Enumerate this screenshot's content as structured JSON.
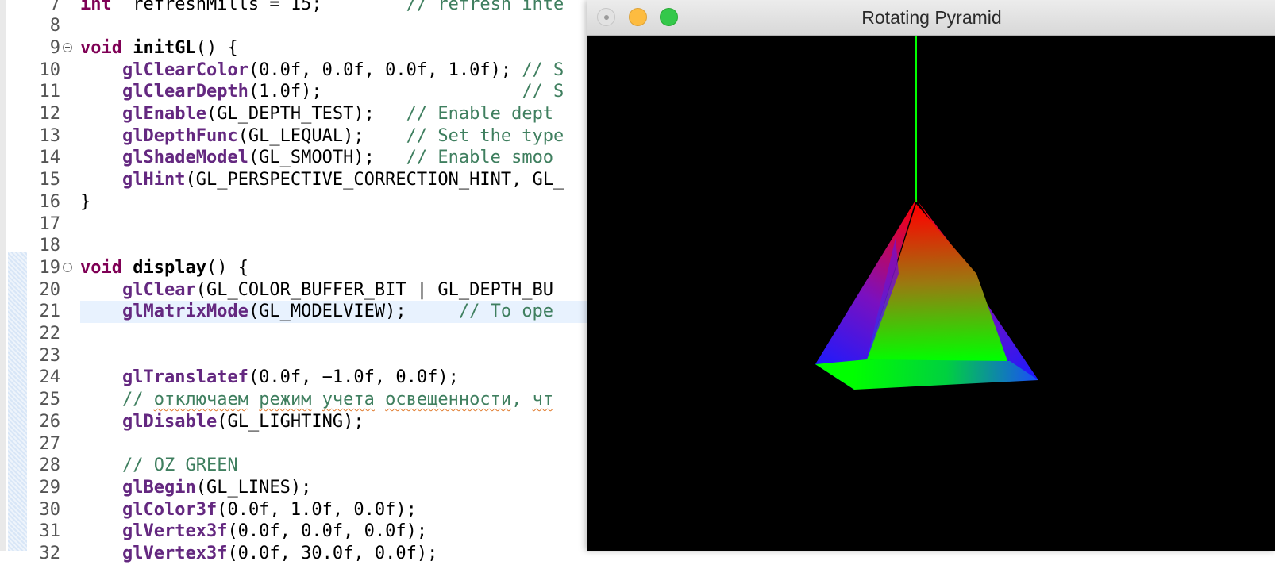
{
  "editor": {
    "lines": [
      {
        "num": "7",
        "parts": [
          [
            "kw",
            "int"
          ],
          [
            "",
            "  refreshMills = 15;"
          ],
          [
            "cm",
            "        // refresh inte"
          ]
        ]
      },
      {
        "num": "8",
        "parts": []
      },
      {
        "num": "9",
        "fold": true,
        "parts": [
          [
            "kw",
            "void"
          ],
          [
            "",
            " "
          ],
          [
            "fnn",
            "initGL"
          ],
          [
            "",
            "() {"
          ]
        ]
      },
      {
        "num": "10",
        "parts": [
          [
            "",
            "    "
          ],
          [
            "fn",
            "glClearColor"
          ],
          [
            "",
            "(0.0f, 0.0f, 0.0f, 1.0f); "
          ],
          [
            "cm",
            "// S"
          ]
        ]
      },
      {
        "num": "11",
        "parts": [
          [
            "",
            "    "
          ],
          [
            "fn",
            "glClearDepth"
          ],
          [
            "",
            "(1.0f);                   "
          ],
          [
            "cm",
            "// S"
          ]
        ]
      },
      {
        "num": "12",
        "parts": [
          [
            "",
            "    "
          ],
          [
            "fn",
            "glEnable"
          ],
          [
            "",
            "(GL_DEPTH_TEST);   "
          ],
          [
            "cm",
            "// Enable dept"
          ]
        ]
      },
      {
        "num": "13",
        "parts": [
          [
            "",
            "    "
          ],
          [
            "fn",
            "glDepthFunc"
          ],
          [
            "",
            "(GL_LEQUAL);    "
          ],
          [
            "cm",
            "// Set the type"
          ]
        ]
      },
      {
        "num": "14",
        "parts": [
          [
            "",
            "    "
          ],
          [
            "fn",
            "glShadeModel"
          ],
          [
            "",
            "(GL_SMOOTH);   "
          ],
          [
            "cm",
            "// Enable smoo"
          ]
        ]
      },
      {
        "num": "15",
        "parts": [
          [
            "",
            "    "
          ],
          [
            "fn",
            "glHint"
          ],
          [
            "",
            "(GL_PERSPECTIVE_CORRECTION_HINT, GL_"
          ]
        ]
      },
      {
        "num": "16",
        "parts": [
          [
            "",
            "}"
          ]
        ]
      },
      {
        "num": "17",
        "parts": []
      },
      {
        "num": "18",
        "parts": []
      },
      {
        "num": "19",
        "fold": true,
        "parts": [
          [
            "kw",
            "void"
          ],
          [
            "",
            " "
          ],
          [
            "fnn",
            "display"
          ],
          [
            "",
            "() {"
          ]
        ]
      },
      {
        "num": "20",
        "parts": [
          [
            "",
            "    "
          ],
          [
            "fn",
            "glClear"
          ],
          [
            "",
            "(GL_COLOR_BUFFER_BIT | GL_DEPTH_BU"
          ]
        ]
      },
      {
        "num": "21",
        "current": true,
        "parts": [
          [
            "",
            "    "
          ],
          [
            "fn",
            "glMatrixMode"
          ],
          [
            "",
            "(GL_MODELVIEW);     "
          ],
          [
            "cm",
            "// To ope"
          ]
        ]
      },
      {
        "num": "22",
        "parts": []
      },
      {
        "num": "23",
        "parts": []
      },
      {
        "num": "24",
        "parts": [
          [
            "",
            "    "
          ],
          [
            "fn",
            "glTranslatef"
          ],
          [
            "",
            "(0.0f, −1.0f, 0.0f);"
          ]
        ]
      },
      {
        "num": "25",
        "parts": [
          [
            "",
            "    "
          ],
          [
            "cm",
            "// "
          ],
          [
            "cm sq",
            "отключаем"
          ],
          [
            "cm",
            " "
          ],
          [
            "cm sq",
            "режим"
          ],
          [
            "cm",
            " "
          ],
          [
            "cm sq",
            "учета"
          ],
          [
            "cm",
            " "
          ],
          [
            "cm sq",
            "освещенности"
          ],
          [
            "cm",
            ", "
          ],
          [
            "cm sq",
            "чт"
          ]
        ]
      },
      {
        "num": "26",
        "parts": [
          [
            "",
            "    "
          ],
          [
            "fn",
            "glDisable"
          ],
          [
            "",
            "(GL_LIGHTING);"
          ]
        ]
      },
      {
        "num": "27",
        "parts": []
      },
      {
        "num": "28",
        "parts": [
          [
            "",
            "    "
          ],
          [
            "cm",
            "// OZ GREEN"
          ]
        ]
      },
      {
        "num": "29",
        "parts": [
          [
            "",
            "    "
          ],
          [
            "fn",
            "glBegin"
          ],
          [
            "",
            "(GL_LINES);"
          ]
        ]
      },
      {
        "num": "30",
        "parts": [
          [
            "",
            "    "
          ],
          [
            "fn",
            "glColor3f"
          ],
          [
            "",
            "(0.0f, 1.0f, 0.0f);"
          ]
        ]
      },
      {
        "num": "31",
        "parts": [
          [
            "",
            "    "
          ],
          [
            "fn",
            "glVertex3f"
          ],
          [
            "",
            "(0.0f, 0.0f, 0.0f);"
          ]
        ]
      },
      {
        "num": "32",
        "parts": [
          [
            "",
            "    "
          ],
          [
            "fn",
            "glVertex3f"
          ],
          [
            "",
            "(0.0f, 30.0f, 0.0f);"
          ]
        ]
      }
    ]
  },
  "gl_window": {
    "title": "Rotating Pyramid",
    "buttons": {
      "close": "close-button",
      "minimize": "minimize-button",
      "maximize": "zoom-button"
    },
    "colors": {
      "background": "#000000",
      "axis": "#00ff00",
      "apex": "#ff0000",
      "left_base": "#1a1aff",
      "right_base": "#1a1aff",
      "front_base": "#00ff00"
    }
  }
}
